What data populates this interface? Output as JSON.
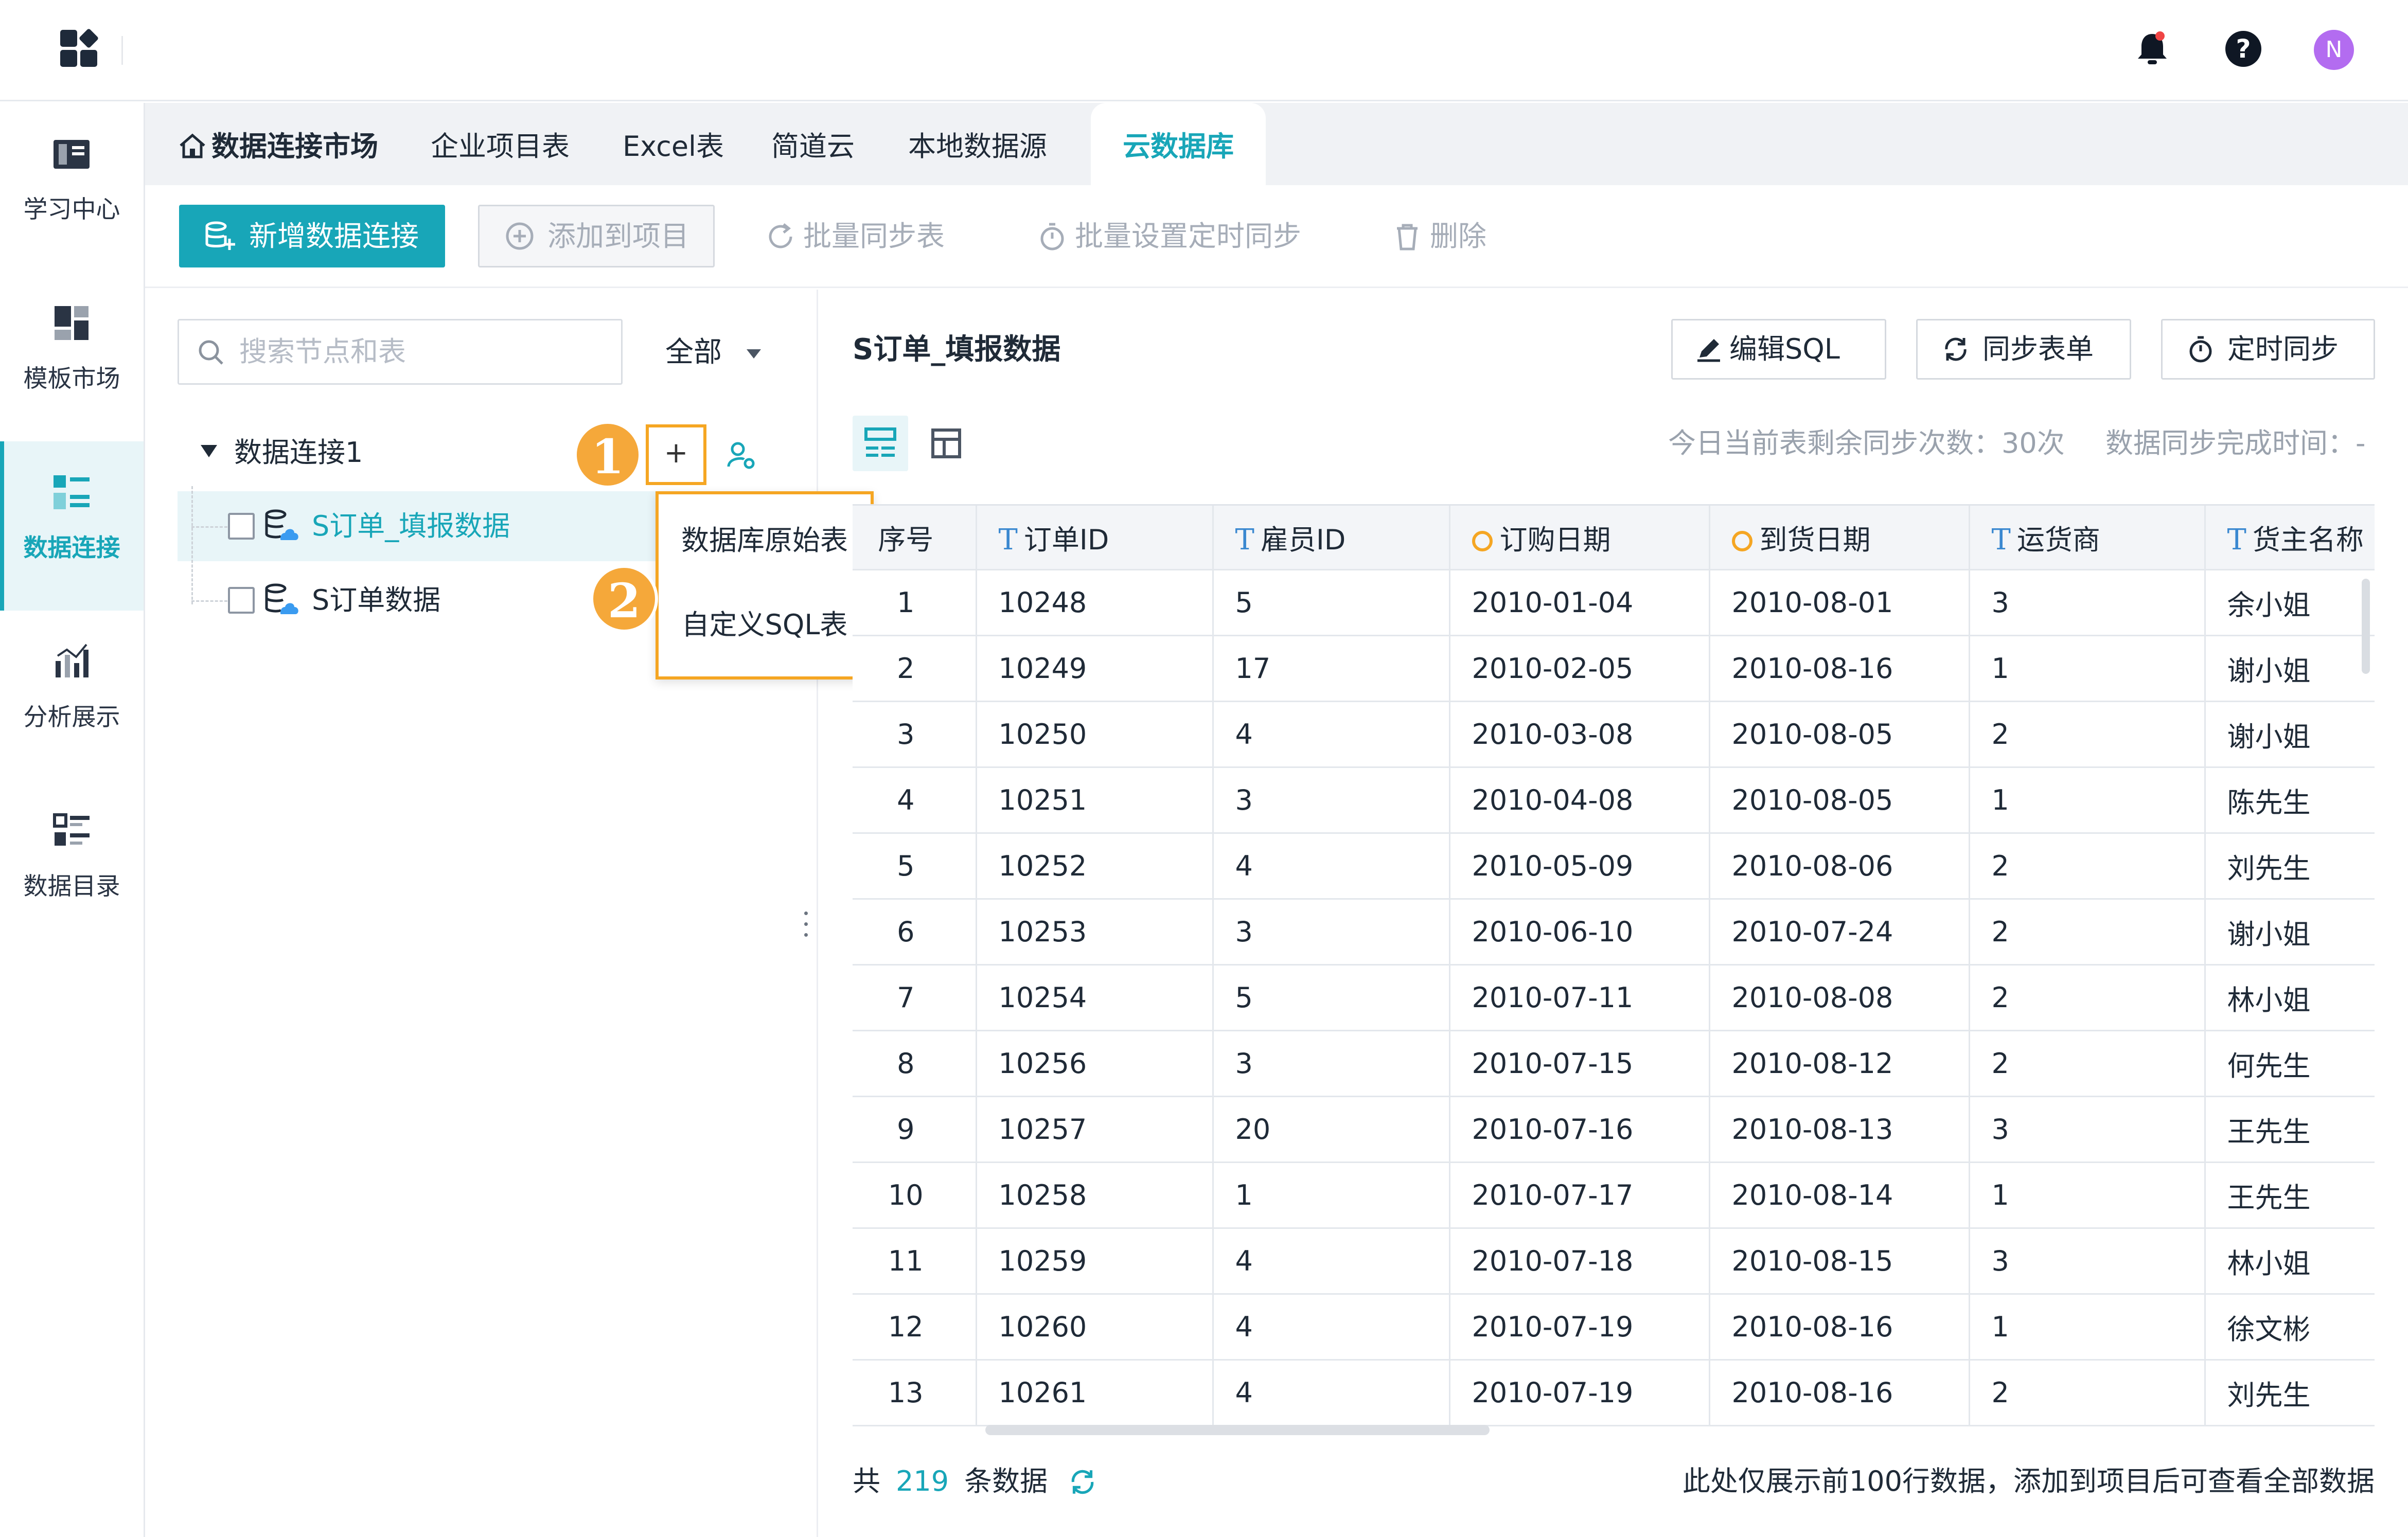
{
  "header": {
    "avatar_letter": "N",
    "help_glyph": "?"
  },
  "sidebar": {
    "items": [
      {
        "label": "学习中心",
        "icon": "book-icon"
      },
      {
        "label": "模板市场",
        "icon": "template-icon"
      },
      {
        "label": "数据连接",
        "icon": "data-connect-icon",
        "active": true
      },
      {
        "label": "分析展示",
        "icon": "chart-icon"
      },
      {
        "label": "数据目录",
        "icon": "catalog-icon"
      }
    ]
  },
  "tabs": [
    {
      "label": "数据连接市场"
    },
    {
      "label": "企业项目表"
    },
    {
      "label": "Excel表"
    },
    {
      "label": "简道云"
    },
    {
      "label": "本地数据源"
    },
    {
      "label": "云数据库",
      "active": true
    }
  ],
  "toolbar": {
    "new_connection": "新增数据连接",
    "add_to_project": "添加到项目",
    "batch_sync": "批量同步表",
    "batch_schedule": "批量设置定时同步",
    "delete": "删除"
  },
  "left_panel": {
    "search_placeholder": "搜索节点和表",
    "filter_label": "全部",
    "tree": {
      "root": "数据连接1",
      "children": [
        {
          "label": "S订单_填报数据",
          "selected": true
        },
        {
          "label": "S订单数据"
        }
      ]
    },
    "add_menu": [
      "数据库原始表",
      "自定义SQL表"
    ],
    "callouts": [
      "1",
      "2"
    ]
  },
  "right_panel": {
    "title": "S订单_填报数据",
    "buttons": {
      "edit_sql": "编辑SQL",
      "sync_form": "同步表单",
      "scheduled_sync": "定时同步"
    },
    "sync_remaining": "今日当前表剩余同步次数：30次",
    "sync_time": "数据同步完成时间：-"
  },
  "table": {
    "columns": [
      {
        "label": "序号",
        "type": ""
      },
      {
        "label": "订单ID",
        "type": "text"
      },
      {
        "label": "雇员ID",
        "type": "text"
      },
      {
        "label": "订购日期",
        "type": "date"
      },
      {
        "label": "到货日期",
        "type": "date"
      },
      {
        "label": "运货商",
        "type": "text"
      },
      {
        "label": "货主名称",
        "type": "text"
      }
    ],
    "rows": [
      [
        "1",
        "10248",
        "5",
        "2010-01-04",
        "2010-08-01",
        "3",
        "余小姐"
      ],
      [
        "2",
        "10249",
        "17",
        "2010-02-05",
        "2010-08-16",
        "1",
        "谢小姐"
      ],
      [
        "3",
        "10250",
        "4",
        "2010-03-08",
        "2010-08-05",
        "2",
        "谢小姐"
      ],
      [
        "4",
        "10251",
        "3",
        "2010-04-08",
        "2010-08-05",
        "1",
        "陈先生"
      ],
      [
        "5",
        "10252",
        "4",
        "2010-05-09",
        "2010-08-06",
        "2",
        "刘先生"
      ],
      [
        "6",
        "10253",
        "3",
        "2010-06-10",
        "2010-07-24",
        "2",
        "谢小姐"
      ],
      [
        "7",
        "10254",
        "5",
        "2010-07-11",
        "2010-08-08",
        "2",
        "林小姐"
      ],
      [
        "8",
        "10256",
        "3",
        "2010-07-15",
        "2010-08-12",
        "2",
        "何先生"
      ],
      [
        "9",
        "10257",
        "20",
        "2010-07-16",
        "2010-08-13",
        "3",
        "王先生"
      ],
      [
        "10",
        "10258",
        "1",
        "2010-07-17",
        "2010-08-14",
        "1",
        "王先生"
      ],
      [
        "11",
        "10259",
        "4",
        "2010-07-18",
        "2010-08-15",
        "3",
        "林小姐"
      ],
      [
        "12",
        "10260",
        "4",
        "2010-07-19",
        "2010-08-16",
        "1",
        "徐文彬"
      ],
      [
        "13",
        "10261",
        "4",
        "2010-07-19",
        "2010-08-16",
        "2",
        "刘先生"
      ]
    ]
  },
  "footer": {
    "prefix": "共",
    "count": "219",
    "suffix": "条数据",
    "note": "此处仅展示前100行数据，添加到项目后可查看全部数据"
  },
  "colors": {
    "accent": "#18a6b8",
    "highlight": "#f5a623",
    "text_type": "#3a88d0"
  }
}
